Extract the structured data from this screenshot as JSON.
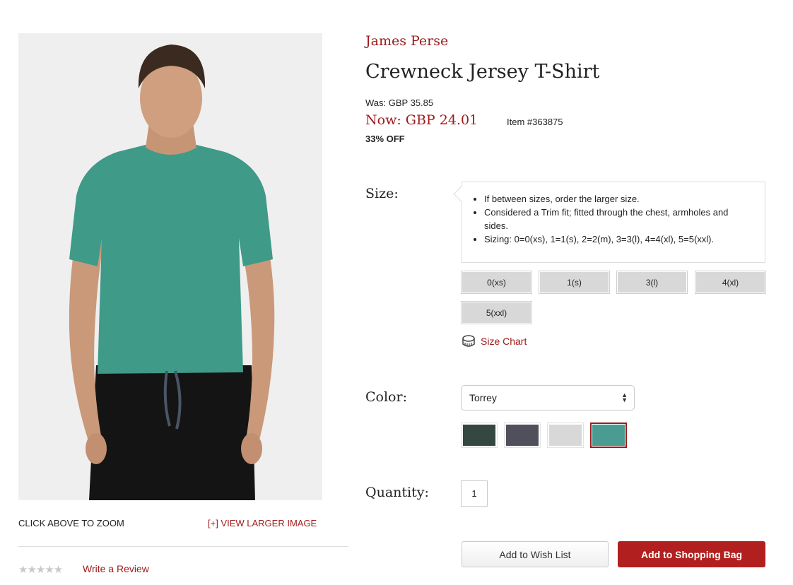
{
  "gallery": {
    "zoom_hint": "CLICK ABOVE TO ZOOM",
    "view_larger": "[+] VIEW LARGER IMAGE",
    "shirt_color": "#3f9a88"
  },
  "reviews": {
    "stars": "★★★★★",
    "rating": 0,
    "write_review": "Write a Review"
  },
  "product": {
    "brand": "James Perse",
    "title": "Crewneck Jersey T-Shirt",
    "was_price": "Was: GBP 35.85",
    "now_price": "Now: GBP 24.01",
    "item_number": "Item #363875",
    "discount": "33% OFF"
  },
  "size": {
    "label": "Size:",
    "tips": [
      "If between sizes, order the larger size.",
      "Considered a Trim fit; fitted through the chest, armholes and sides.",
      "Sizing: 0=0(xs), 1=1(s), 2=2(m), 3=3(l), 4=4(xl), 5=5(xxl)."
    ],
    "options": [
      "0(xs)",
      "1(s)",
      "3(l)",
      "4(xl)",
      "5(xxl)"
    ],
    "chart_link": "Size Chart",
    "chart_icon": "measuring-tape-icon"
  },
  "color": {
    "label": "Color:",
    "selected": "Torrey",
    "swatches": [
      {
        "name": "dark-green",
        "hex": "#344741"
      },
      {
        "name": "charcoal",
        "hex": "#50505c"
      },
      {
        "name": "light-grey",
        "hex": "#d8d8d8"
      },
      {
        "name": "torrey",
        "hex": "#4a9c92",
        "selected": true
      }
    ]
  },
  "quantity": {
    "label": "Quantity:",
    "value": "1"
  },
  "actions": {
    "wish_list": "Add to Wish List",
    "add_to_bag": "Add to Shopping Bag",
    "accent": "#b21f1f"
  }
}
